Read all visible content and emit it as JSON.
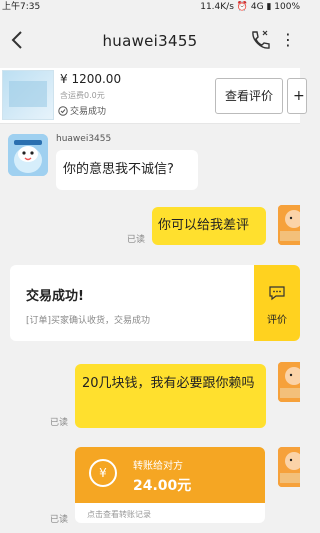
{
  "status_bar": {
    "time": "上午7:35",
    "net": "11.4K/s",
    "signal": "4G",
    "battery": "100%"
  },
  "header": {
    "title": "huawei3455"
  },
  "product": {
    "price": "¥ 1200.00",
    "shipping": "含运费0.0元",
    "status": "交易成功",
    "review_button": "查看评价"
  },
  "chat": {
    "sender_name": "huawei3455",
    "messages": [
      {
        "side": "left",
        "text": "你的意思我不诚信?"
      },
      {
        "side": "right",
        "text": "你可以给我差评",
        "read": "已读"
      },
      {
        "side": "right",
        "text": "20几块钱，我有必要跟你赖吗",
        "read": "已读"
      }
    ]
  },
  "trade_card": {
    "title": "交易成功!",
    "subtitle": "[订单]买家确认收货，交易成功",
    "action": "评价"
  },
  "transfer": {
    "label": "转账给对方",
    "amount": "24.00元",
    "footer": "点击查看转账记录",
    "read": "已读"
  },
  "colors": {
    "bubble_self": "#ffe02e",
    "transfer": "#f5a623"
  }
}
